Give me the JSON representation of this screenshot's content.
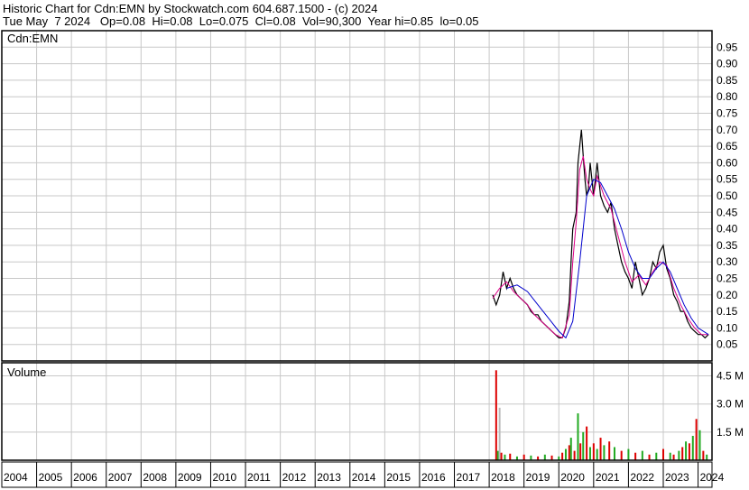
{
  "header": {
    "line1": "Historic Chart for Cdn:EMN by Stockwatch.com 604.687.1500 - (c) 2024",
    "line2": "Tue May  7 2024   Op=0.08  Hi=0.08  Lo=0.075  Cl=0.08  Vol=90,300  Year hi=0.85  lo=0.05"
  },
  "chart_data": [
    {
      "type": "line",
      "title": "Cdn:EMN",
      "ylim": [
        0,
        1.0
      ],
      "y_ticks": [
        "0.95",
        "0.90",
        "0.85",
        "0.80",
        "0.75",
        "0.70",
        "0.65",
        "0.60",
        "0.55",
        "0.50",
        "0.45",
        "0.40",
        "0.35",
        "0.30",
        "0.25",
        "0.20",
        "0.15",
        "0.10",
        "0.05"
      ],
      "xlim": [
        2004.0,
        2024.4
      ],
      "x_ticks": [
        "2004",
        "2005",
        "2006",
        "2007",
        "2008",
        "2009",
        "2010",
        "2011",
        "2012",
        "2013",
        "2014",
        "2015",
        "2016",
        "2017",
        "2018",
        "2019",
        "2020",
        "2021",
        "2022",
        "2023",
        "2024"
      ],
      "grid": true,
      "series": [
        {
          "color": "#000000",
          "x": [
            2018.1,
            2018.2,
            2018.3,
            2018.4,
            2018.5,
            2018.6,
            2018.7,
            2018.8,
            2018.9,
            2019.0,
            2019.1,
            2019.2,
            2019.3,
            2019.4,
            2019.5,
            2019.6,
            2019.7,
            2019.8,
            2019.9,
            2020.0,
            2020.1,
            2020.2,
            2020.3,
            2020.35,
            2020.4,
            2020.5,
            2020.55,
            2020.6,
            2020.65,
            2020.7,
            2020.75,
            2020.8,
            2020.85,
            2020.9,
            2021.0,
            2021.05,
            2021.1,
            2021.2,
            2021.3,
            2021.4,
            2021.5,
            2021.6,
            2021.7,
            2021.8,
            2021.9,
            2022.0,
            2022.1,
            2022.2,
            2022.3,
            2022.4,
            2022.5,
            2022.6,
            2022.7,
            2022.8,
            2022.9,
            2023.0,
            2023.1,
            2023.2,
            2023.3,
            2023.4,
            2023.5,
            2023.6,
            2023.7,
            2023.8,
            2023.9,
            2024.0,
            2024.1,
            2024.2,
            2024.3
          ],
          "values": [
            0.2,
            0.17,
            0.2,
            0.27,
            0.22,
            0.25,
            0.22,
            0.2,
            0.19,
            0.18,
            0.17,
            0.15,
            0.14,
            0.14,
            0.12,
            0.11,
            0.1,
            0.09,
            0.08,
            0.07,
            0.07,
            0.1,
            0.18,
            0.3,
            0.4,
            0.45,
            0.6,
            0.65,
            0.7,
            0.62,
            0.55,
            0.5,
            0.52,
            0.6,
            0.5,
            0.55,
            0.6,
            0.5,
            0.47,
            0.45,
            0.48,
            0.4,
            0.35,
            0.3,
            0.27,
            0.25,
            0.22,
            0.3,
            0.25,
            0.2,
            0.22,
            0.25,
            0.3,
            0.28,
            0.33,
            0.35,
            0.28,
            0.25,
            0.2,
            0.18,
            0.15,
            0.15,
            0.12,
            0.1,
            0.09,
            0.08,
            0.08,
            0.07,
            0.08
          ]
        },
        {
          "color": "#dd0088",
          "x": [
            2018.1,
            2018.3,
            2018.5,
            2018.7,
            2018.9,
            2019.1,
            2019.3,
            2019.5,
            2019.7,
            2019.9,
            2020.1,
            2020.3,
            2020.4,
            2020.5,
            2020.6,
            2020.7,
            2020.8,
            2020.9,
            2021.0,
            2021.1,
            2021.3,
            2021.5,
            2021.7,
            2021.9,
            2022.1,
            2022.3,
            2022.5,
            2022.7,
            2022.9,
            2023.1,
            2023.3,
            2023.5,
            2023.7,
            2023.9,
            2024.1,
            2024.3
          ],
          "values": [
            0.19,
            0.22,
            0.24,
            0.21,
            0.19,
            0.17,
            0.14,
            0.12,
            0.1,
            0.08,
            0.07,
            0.14,
            0.3,
            0.42,
            0.58,
            0.62,
            0.55,
            0.52,
            0.5,
            0.56,
            0.5,
            0.46,
            0.38,
            0.3,
            0.24,
            0.26,
            0.23,
            0.27,
            0.3,
            0.29,
            0.22,
            0.17,
            0.13,
            0.1,
            0.08,
            0.08
          ]
        },
        {
          "color": "#0000cc",
          "x": [
            2018.5,
            2018.8,
            2019.1,
            2019.4,
            2019.7,
            2020.0,
            2020.2,
            2020.4,
            2020.6,
            2020.8,
            2021.0,
            2021.2,
            2021.4,
            2021.6,
            2021.8,
            2022.0,
            2022.2,
            2022.4,
            2022.6,
            2022.8,
            2023.0,
            2023.2,
            2023.4,
            2023.6,
            2023.8,
            2024.0,
            2024.3
          ],
          "values": [
            0.22,
            0.23,
            0.21,
            0.17,
            0.13,
            0.09,
            0.07,
            0.12,
            0.3,
            0.5,
            0.55,
            0.54,
            0.5,
            0.46,
            0.4,
            0.33,
            0.28,
            0.25,
            0.25,
            0.28,
            0.3,
            0.27,
            0.22,
            0.17,
            0.13,
            0.1,
            0.08
          ]
        }
      ]
    },
    {
      "type": "bar",
      "title": "Volume",
      "ylim": [
        0,
        5.2
      ],
      "y_ticks": [
        "4.5 M",
        "3.0 M",
        "1.5 M"
      ],
      "series": [
        {
          "x": [
            2018.2,
            2018.25,
            2018.3,
            2018.35,
            2018.45,
            2018.6,
            2018.8,
            2019.0,
            2019.2,
            2019.4,
            2019.6,
            2019.8,
            2020.0,
            2020.1,
            2020.2,
            2020.3,
            2020.35,
            2020.45,
            2020.55,
            2020.62,
            2020.7,
            2020.8,
            2020.9,
            2021.0,
            2021.1,
            2021.2,
            2021.3,
            2021.45,
            2021.6,
            2021.8,
            2022.0,
            2022.2,
            2022.4,
            2022.6,
            2022.8,
            2023.0,
            2023.2,
            2023.3,
            2023.45,
            2023.55,
            2023.65,
            2023.75,
            2023.85,
            2023.95,
            2024.05,
            2024.15,
            2024.25
          ],
          "values": [
            4.8,
            0.5,
            2.8,
            0.4,
            0.3,
            0.35,
            0.2,
            0.3,
            0.25,
            0.2,
            0.3,
            0.25,
            0.2,
            0.4,
            0.6,
            0.8,
            1.2,
            0.5,
            2.5,
            0.9,
            1.5,
            1.8,
            0.7,
            0.9,
            0.6,
            1.2,
            0.8,
            1.0,
            0.7,
            0.5,
            0.6,
            0.4,
            0.5,
            0.3,
            0.4,
            0.6,
            0.4,
            0.3,
            0.5,
            0.7,
            1.0,
            0.9,
            1.3,
            2.2,
            1.6,
            0.5,
            0.3
          ],
          "colors": [
            "#dd0000",
            "#22aa22",
            "#bbbbbb",
            "#dd0000",
            "#22aa22",
            "#dd0000",
            "#22aa22",
            "#dd0000",
            "#22aa22",
            "#dd0000",
            "#22aa22",
            "#dd0000",
            "#22aa22",
            "#dd0000",
            "#22aa22",
            "#dd0000",
            "#22aa22",
            "#dd0000",
            "#22aa22",
            "#dd0000",
            "#22aa22",
            "#dd0000",
            "#22aa22",
            "#dd0000",
            "#22aa22",
            "#dd0000",
            "#22aa22",
            "#dd0000",
            "#22aa22",
            "#dd0000",
            "#22aa22",
            "#dd0000",
            "#22aa22",
            "#dd0000",
            "#22aa22",
            "#dd0000",
            "#22aa22",
            "#dd0000",
            "#22aa22",
            "#dd0000",
            "#22aa22",
            "#dd0000",
            "#22aa22",
            "#dd0000",
            "#22aa22",
            "#dd0000",
            "#22aa22"
          ]
        }
      ]
    }
  ]
}
